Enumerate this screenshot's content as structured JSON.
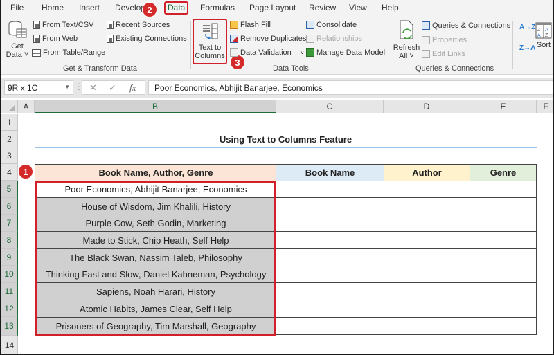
{
  "menu": {
    "tabs": [
      "File",
      "Home",
      "Insert",
      "Develop",
      "Data",
      "Formulas",
      "Page Layout",
      "Review",
      "View",
      "Help"
    ],
    "active_tab": "Data"
  },
  "ribbon": {
    "get_transform": {
      "get_data": "Get Data",
      "get_data_line1": "Get",
      "get_data_line2": "Data ˅",
      "from_text_csv": "From Text/CSV",
      "from_web": "From Web",
      "from_table_range": "From Table/Range",
      "recent_sources": "Recent Sources",
      "existing_connections": "Existing Connections",
      "label": "Get & Transform Data"
    },
    "data_tools": {
      "text_to_columns_line1": "Text to",
      "text_to_columns_line2": "Columns",
      "flash_fill": "Flash Fill",
      "remove_duplicates": "Remove Duplicates",
      "data_validation": "Data Validation",
      "data_validation_dd": "˅",
      "consolidate": "Consolidate",
      "relationships": "Relationships",
      "manage_data_model": "Manage Data Model",
      "label": "Data Tools"
    },
    "queries": {
      "refresh_line1": "Refresh",
      "refresh_line2": "All ˅",
      "queries_connections": "Queries & Connections",
      "properties": "Properties",
      "edit_links": "Edit Links",
      "label": "Queries & Connections"
    },
    "sort": {
      "sort_az": "A→Z",
      "sort_za": "Z→A",
      "sort_label": "Sort"
    }
  },
  "badges": {
    "step1": "1",
    "step2": "2",
    "step3": "3"
  },
  "formula_bar": {
    "name_box": "9R x 1C",
    "cancel": "✕",
    "enter": "✓",
    "fx": "fx",
    "value": "Poor Economics, Abhijit Banarjee, Economics"
  },
  "sheet": {
    "columns": [
      "A",
      "B",
      "C",
      "D",
      "E",
      "F"
    ],
    "rows": [
      "1",
      "2",
      "3",
      "4",
      "5",
      "6",
      "7",
      "8",
      "9",
      "10",
      "11",
      "12",
      "13",
      "14"
    ],
    "title": "Using Text to Columns Feature",
    "headers": {
      "combined": "Book Name, Author, Genre",
      "book_name": "Book Name",
      "author": "Author",
      "genre": "Genre"
    },
    "header_colors": {
      "combined": "#fce4d6",
      "book_name": "#ddebf7",
      "author": "#fff2cc",
      "genre": "#e2efda"
    },
    "data": [
      "Poor Economics, Abhijit Banarjee, Economics",
      "House of Wisdom, Jim Khalili, History",
      "Purple Cow, Seth Godin, Marketing",
      "Made to Stick, Chip Heath, Self Help",
      "The Black Swan, Nassim Taleb, Philosophy",
      "Thinking Fast and Slow, Daniel Kahneman, Psychology",
      "Sapiens, Noah Harari, History",
      "Atomic Habits, James Clear, Self Help",
      "Prisoners of Geography, Tim Marshall, Geography"
    ]
  }
}
